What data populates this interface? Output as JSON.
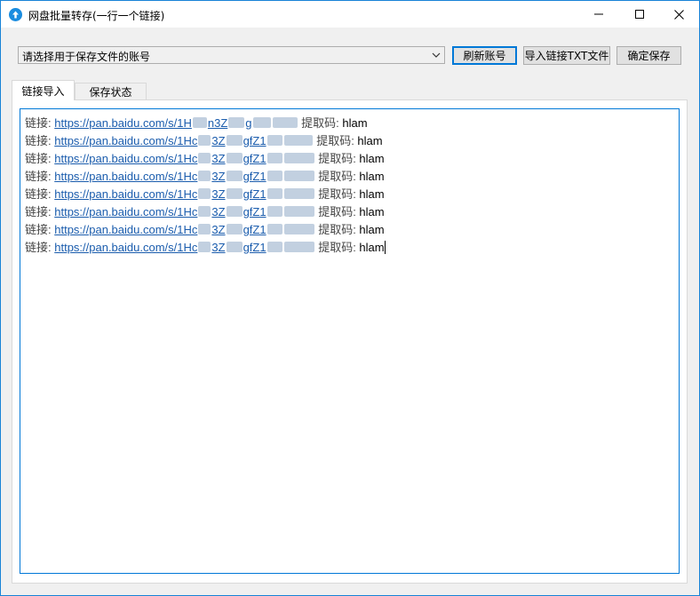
{
  "window": {
    "title": "网盘批量转存(一行一个链接)",
    "controls": {
      "minimize": "—",
      "maximize": "☐",
      "close": "✕"
    }
  },
  "toolbar": {
    "account_select": {
      "selected": "请选择用于保存文件的账号"
    },
    "refresh_label": "刷新账号",
    "import_label": "导入链接TXT文件",
    "save_label": "确定保存"
  },
  "tabs": [
    {
      "label": "链接导入",
      "active": true
    },
    {
      "label": "保存状态",
      "active": false
    }
  ],
  "editor": {
    "lines": [
      {
        "prefix": "链接:",
        "url": "https://pan.baidu.com/s/1H",
        "code_label": "提取码:",
        "code": "hlam"
      },
      {
        "prefix": "链接:",
        "url": "https://pan.baidu.com/s/1Hc",
        "code_label": "提取码:",
        "code": "hlam"
      },
      {
        "prefix": "链接:",
        "url": "https://pan.baidu.com/s/1Hc",
        "code_label": "提取码:",
        "code": "hlam"
      },
      {
        "prefix": "链接:",
        "url": "https://pan.baidu.com/s/1Hc",
        "code_label": "提取码:",
        "code": "hlam"
      },
      {
        "prefix": "链接:",
        "url": "https://pan.baidu.com/s/1Hc",
        "code_label": "提取码:",
        "code": "hlam"
      },
      {
        "prefix": "链接:",
        "url": "https://pan.baidu.com/s/1Hc",
        "code_label": "提取码:",
        "code": "hlam"
      },
      {
        "prefix": "链接:",
        "url": "https://pan.baidu.com/s/1Hc",
        "code_label": "提取码:",
        "code": "hlam"
      },
      {
        "prefix": "链接:",
        "url": "https://pan.baidu.com/s/1Hc",
        "code_label": "提取码:",
        "code": "hlam"
      }
    ]
  },
  "colors": {
    "accent": "#0078d7",
    "link": "#1a5cad",
    "app_icon": "#1a8cdf"
  }
}
